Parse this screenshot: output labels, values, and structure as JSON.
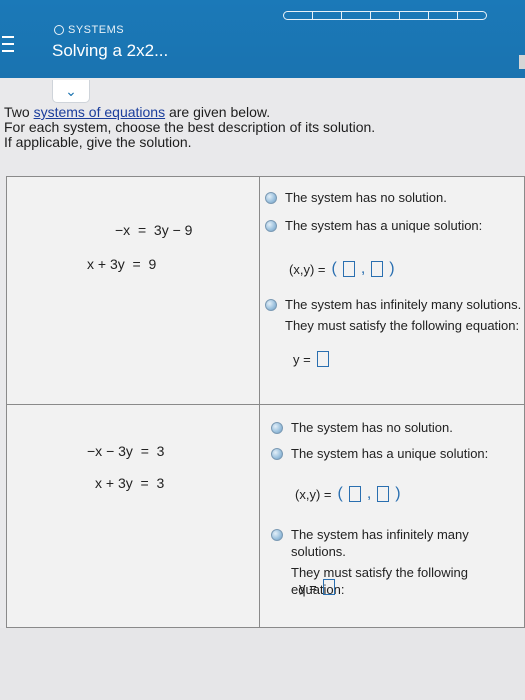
{
  "header": {
    "topic": "SYSTEMS",
    "title": "Solving a 2x2...",
    "progress_segments": 6
  },
  "intro": {
    "line1_pre": "Two ",
    "line1_link": "systems of equations",
    "line1_post": " are given below.",
    "line2": "For each system, choose the best description of its solution.",
    "line3": "If applicable, give the solution."
  },
  "systems": [
    {
      "eq1": "−x  =  3y − 9",
      "eq2": "x + 3y  =  9",
      "opt_none": "The system has no solution.",
      "opt_unique": "The system has a unique solution:",
      "solution_label": "(x,y) =",
      "opt_infinite_1": "The system has infinitely many solutions.",
      "opt_infinite_2": "They must satisfy the following equation:",
      "y_label": "y ="
    },
    {
      "eq1": "−x − 3y  =  3",
      "eq2": "x + 3y  =  3",
      "opt_none": "The system has no solution.",
      "opt_unique": "The system has a unique solution:",
      "solution_label": "(x,y) =",
      "opt_infinite_1": "The system has infinitely many solutions.",
      "opt_infinite_2": "They must satisfy the following equation:",
      "y_label": "y ="
    }
  ]
}
